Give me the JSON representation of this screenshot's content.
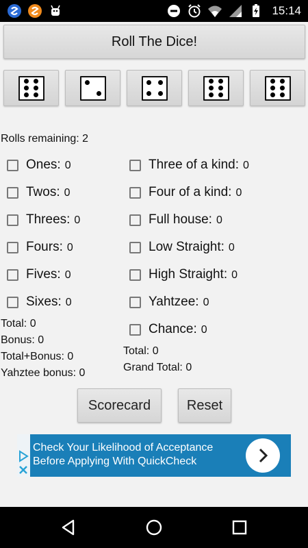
{
  "status_bar": {
    "time": "15:14"
  },
  "roll_button": {
    "label": "Roll The Dice!"
  },
  "dice": [
    {
      "value": 6
    },
    {
      "value": 2
    },
    {
      "value": 4
    },
    {
      "value": 6
    },
    {
      "value": 6
    }
  ],
  "rolls_remaining": "Rolls remaining: 2",
  "upper": [
    {
      "label": "Ones:",
      "value": "0"
    },
    {
      "label": "Twos:",
      "value": "0"
    },
    {
      "label": "Threes:",
      "value": "0"
    },
    {
      "label": "Fours:",
      "value": "0"
    },
    {
      "label": "Fives:",
      "value": "0"
    },
    {
      "label": "Sixes:",
      "value": "0"
    }
  ],
  "lower": [
    {
      "label": "Three of a kind:",
      "value": "0"
    },
    {
      "label": "Four of a kind:",
      "value": "0"
    },
    {
      "label": "Full house:",
      "value": "0"
    },
    {
      "label": "Low Straight:",
      "value": "0"
    },
    {
      "label": "High Straight:",
      "value": "0"
    },
    {
      "label": "Yahtzee:",
      "value": "0"
    },
    {
      "label": "Chance:",
      "value": "0"
    }
  ],
  "upper_summary": {
    "total": "Total: 0",
    "bonus": "Bonus: 0",
    "total_bonus": "Total+Bonus: 0",
    "yahtzee_bonus": "Yahztee bonus: 0"
  },
  "lower_summary": {
    "total": "Total: 0",
    "grand_total": "Grand Total: 0"
  },
  "buttons": {
    "scorecard": "Scorecard",
    "reset": "Reset"
  },
  "ad": {
    "line1": "Check Your Likelihood of Acceptance",
    "line2": "Before Applying With QuickCheck",
    "close_label": "✕"
  },
  "colors": {
    "ad_background": "#1a7fb8",
    "background": "#f2f2f2"
  }
}
